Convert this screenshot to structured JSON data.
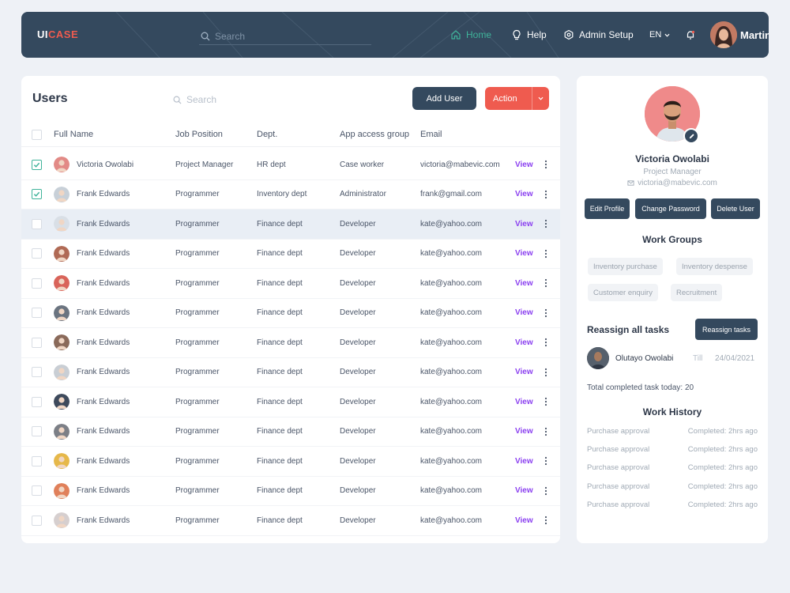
{
  "app": {
    "logo_part1": "UI",
    "logo_part2": "CASE"
  },
  "colors": {
    "nav_bg": "#34495e",
    "accent_red": "#ef5b4f",
    "accent_green": "#3fb39a",
    "view_link": "#8a3ff0",
    "page_bg": "#eef1f6"
  },
  "topnav": {
    "search_placeholder": "Search",
    "home": "Home",
    "help": "Help",
    "admin_setup": "Admin Setup",
    "language": "EN",
    "user_name": "Martin",
    "icons": [
      "search-icon",
      "home-icon",
      "help-bulb-icon",
      "gear-icon",
      "chevron-down-icon",
      "bell-icon"
    ]
  },
  "users_panel": {
    "title": "Users",
    "search_placeholder": "Search",
    "add_user": "Add User",
    "action": "Action",
    "columns": [
      "Full Name",
      "Job Position",
      "Dept.",
      "App access group",
      "Email"
    ],
    "view_label": "View",
    "rows": [
      {
        "checked": true,
        "name": "Victoria Owolabi",
        "job": "Project Manager",
        "dept": "HR dept",
        "group": "Case worker",
        "email": "victoria@mabevic.com",
        "avatar_color": "#e28a86"
      },
      {
        "checked": true,
        "name": "Frank Edwards",
        "job": "Programmer",
        "dept": "Inventory dept",
        "group": "Administrator",
        "email": "frank@gmail.com",
        "avatar_color": "#c8d0d8"
      },
      {
        "checked": false,
        "highlight": true,
        "name": "Frank Edwards",
        "job": "Programmer",
        "dept": "Finance dept",
        "group": "Developer",
        "email": "kate@yahoo.com",
        "avatar_color": "#d9dfe6"
      },
      {
        "checked": false,
        "name": "Frank Edwards",
        "job": "Programmer",
        "dept": "Finance dept",
        "group": "Developer",
        "email": "kate@yahoo.com",
        "avatar_color": "#b06a55"
      },
      {
        "checked": false,
        "name": "Frank Edwards",
        "job": "Programmer",
        "dept": "Finance dept",
        "group": "Developer",
        "email": "kate@yahoo.com",
        "avatar_color": "#d9645a"
      },
      {
        "checked": false,
        "name": "Frank Edwards",
        "job": "Programmer",
        "dept": "Finance dept",
        "group": "Developer",
        "email": "kate@yahoo.com",
        "avatar_color": "#6b7480"
      },
      {
        "checked": false,
        "name": "Frank Edwards",
        "job": "Programmer",
        "dept": "Finance dept",
        "group": "Developer",
        "email": "kate@yahoo.com",
        "avatar_color": "#8a6a5a"
      },
      {
        "checked": false,
        "name": "Frank Edwards",
        "job": "Programmer",
        "dept": "Finance dept",
        "group": "Developer",
        "email": "kate@yahoo.com",
        "avatar_color": "#c9ced4"
      },
      {
        "checked": false,
        "name": "Frank Edwards",
        "job": "Programmer",
        "dept": "Finance dept",
        "group": "Developer",
        "email": "kate@yahoo.com",
        "avatar_color": "#3e4a5c"
      },
      {
        "checked": false,
        "name": "Frank Edwards",
        "job": "Programmer",
        "dept": "Finance dept",
        "group": "Developer",
        "email": "kate@yahoo.com",
        "avatar_color": "#7c7f86"
      },
      {
        "checked": false,
        "name": "Frank Edwards",
        "job": "Programmer",
        "dept": "Finance dept",
        "group": "Developer",
        "email": "kate@yahoo.com",
        "avatar_color": "#e6b84a"
      },
      {
        "checked": false,
        "name": "Frank Edwards",
        "job": "Programmer",
        "dept": "Finance dept",
        "group": "Developer",
        "email": "kate@yahoo.com",
        "avatar_color": "#e0805a"
      },
      {
        "checked": false,
        "name": "Frank Edwards",
        "job": "Programmer",
        "dept": "Finance dept",
        "group": "Developer",
        "email": "kate@yahoo.com",
        "avatar_color": "#d6cfcf"
      }
    ]
  },
  "profile": {
    "name": "Victoria Owolabi",
    "role": "Project Manager",
    "email": "victoria@mabevic.com",
    "edit_profile": "Edit Profile",
    "change_password": "Change Password",
    "delete_user": "Delete User",
    "work_groups_title": "Work Groups",
    "work_groups": [
      "Inventory purchase",
      "Inventory despense",
      "Customer enquiry",
      "Recruitment"
    ],
    "reassign_label": "Reassign all tasks",
    "reassign_button": "Reassign tasks",
    "assignee_name": "Olutayo Owolabi",
    "assignee_sep": "Till",
    "assignee_date": "24/04/2021",
    "total_completed": "Total completed task today: 20",
    "work_history_title": "Work History",
    "work_history": [
      {
        "task": "Purchase approval",
        "status": "Completed: 2hrs ago"
      },
      {
        "task": "Purchase approval",
        "status": "Completed: 2hrs ago"
      },
      {
        "task": "Purchase approval",
        "status": "Completed: 2hrs ago"
      },
      {
        "task": "Purchase approval",
        "status": "Completed: 2hrs ago"
      },
      {
        "task": "Purchase approval",
        "status": "Completed: 2hrs ago"
      }
    ]
  }
}
